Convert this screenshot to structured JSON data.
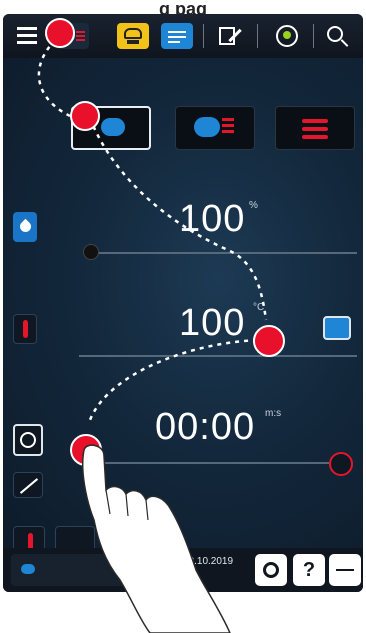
{
  "page_heading": "g          pag",
  "steam_setting": {
    "value": "100",
    "unit": "%"
  },
  "temperature_setting": {
    "value": "100",
    "unit": "°C"
  },
  "time_setting": {
    "value": "00:00",
    "unit": "m:s"
  },
  "status": {
    "date": "08.10.2019"
  },
  "bottombar": {
    "help_label": "?"
  },
  "colors": {
    "marker": "#e8102a",
    "steam_blue": "#1a74c8",
    "heat_red": "#e5162b",
    "screen": "#13283c"
  },
  "icons": [
    "menu-icon",
    "steam-heat-mode-icon",
    "chef-hat-icon",
    "program-list-icon",
    "edit-icon",
    "energy-icon",
    "search-icon",
    "steam-icon",
    "convection-icon",
    "heat-icon",
    "humidity-icon",
    "thermometer-icon",
    "water-bath-icon",
    "timer-icon",
    "probe-icon",
    "core-temperature-icon",
    "settings-icon",
    "back-icon"
  ]
}
